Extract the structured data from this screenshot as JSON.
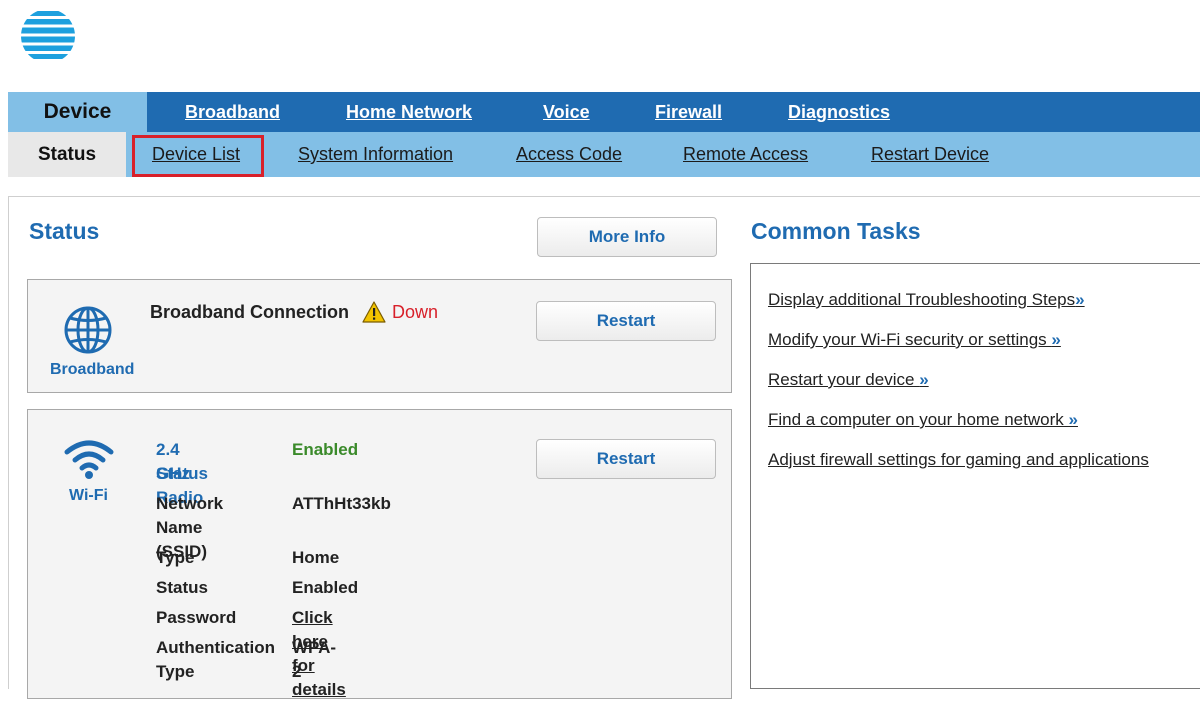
{
  "brand": {
    "logo_icon": "att-globe-icon",
    "accent": "#1f6bb1",
    "light_blue": "#82bfe6",
    "highlight": "#d8202a"
  },
  "top_nav": {
    "active": "Device",
    "items": [
      "Broadband",
      "Home Network",
      "Voice",
      "Firewall",
      "Diagnostics"
    ]
  },
  "sub_nav": {
    "active": "Status",
    "items": [
      "Device List",
      "System Information",
      "Access Code",
      "Remote Access",
      "Restart Device"
    ]
  },
  "status": {
    "title": "Status",
    "more_info": "More Info",
    "broadband": {
      "icon": "globe-icon",
      "icon_label": "Broadband",
      "label": "Broadband Connection",
      "state_icon": "warning-icon",
      "state": "Down",
      "restart": "Restart"
    },
    "wifi": {
      "icon": "wifi-icon",
      "icon_label": "Wi-Fi",
      "restart": "Restart",
      "radio_label_1": "2.4 GHz Radio",
      "radio_label_2": "Status",
      "radio_value": "Enabled",
      "ssid_label_1": "Network",
      "ssid_label_2": "Name (SSID)",
      "ssid_value": "ATThHt33kb",
      "type_label": "Type",
      "type_value": "Home",
      "status_label": "Status",
      "status_value": "Enabled",
      "password_label": "Password",
      "password_value": "Click here for details",
      "auth_label_1": "Authentication",
      "auth_label_2": "Type",
      "auth_value": "WPA-2"
    }
  },
  "common_tasks": {
    "title": "Common Tasks",
    "links": [
      {
        "text": "Display additional Troubleshooting Steps",
        "arrow": "»"
      },
      {
        "text": "Modify your Wi-Fi security or settings ",
        "arrow": "»"
      },
      {
        "text": "Restart your device ",
        "arrow": "»"
      },
      {
        "text": "Find a computer on your home network ",
        "arrow": "»"
      },
      {
        "text": "Adjust firewall settings for gaming and applications",
        "arrow": ""
      }
    ]
  }
}
